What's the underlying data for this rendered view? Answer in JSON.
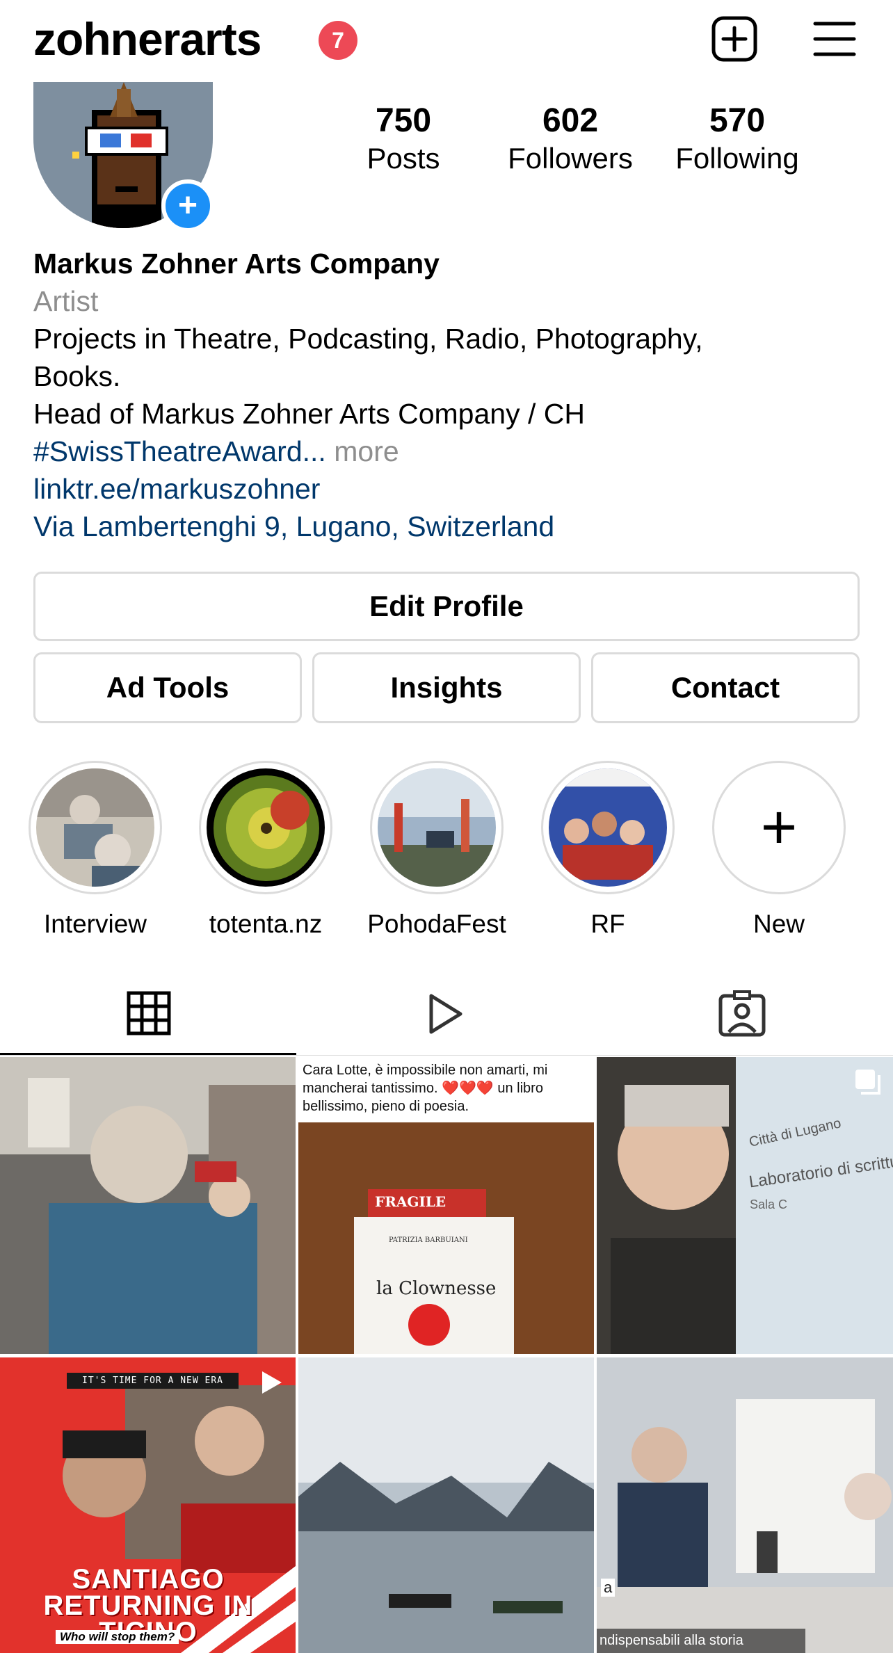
{
  "header": {
    "username": "zohnerarts",
    "notification_count": "7",
    "create_icon": "plus-square-icon",
    "menu_icon": "hamburger-menu-icon"
  },
  "profile": {
    "add_story_symbol": "+",
    "stats": {
      "posts_count": "750",
      "posts_label": "Posts",
      "followers_count": "602",
      "followers_label": "Followers",
      "following_count": "570",
      "following_label": "Following"
    }
  },
  "bio": {
    "name": "Markus Zohner Arts Company",
    "category": "Artist",
    "line1": "Projects in Theatre, Podcasting, Radio, Photography,",
    "line2": "Books.",
    "line3": "Head of Markus Zohner Arts Company / CH",
    "hashtag": "#SwissTheatreAward",
    "ellipsis": "...",
    "more": "more",
    "link": "linktr.ee/markuszohner",
    "address": "Via Lambertenghi 9, Lugano, Switzerland"
  },
  "buttons": {
    "edit_profile": "Edit Profile",
    "ad_tools": "Ad Tools",
    "insights": "Insights",
    "contact": "Contact"
  },
  "highlights": [
    {
      "label": "Interview"
    },
    {
      "label": "totenta.nz"
    },
    {
      "label": "PohodaFest"
    },
    {
      "label": "RF"
    },
    {
      "label": "New",
      "symbol": "+"
    }
  ],
  "tabs": [
    {
      "icon": "grid-icon",
      "active": true
    },
    {
      "icon": "reels-play-icon",
      "active": false
    },
    {
      "icon": "tagged-person-icon",
      "active": false
    }
  ],
  "posts": {
    "post2_caption": "Cara Lotte, è impossibile non amarti, mi mancherai tantissimo. ❤️❤️❤️ un libro bellissimo, pieno di poesia.",
    "post2_fragile": "FRAGILE",
    "post2_author": "PATRIZIA BARBUIANI",
    "post2_title": "la Clownesse",
    "post3_text_a": "Città di Lugano",
    "post3_text_b": "Laboratorio di scrittura",
    "post3_text_c": "Sala C",
    "post4_pill": "IT'S TIME FOR A NEW ERA",
    "post4_title": "SANTIAGO RETURNING IN TICINO",
    "post4_sub": "Who will stop them?",
    "post6_caption": "ndispensabili alla storia",
    "post6_letter": "a"
  },
  "colors": {
    "badge_red": "#ed4956",
    "link_blue": "#00376b",
    "add_blue": "#1b90f7",
    "border_gray": "#dbdbdb",
    "muted_gray": "#8e8e8e"
  }
}
